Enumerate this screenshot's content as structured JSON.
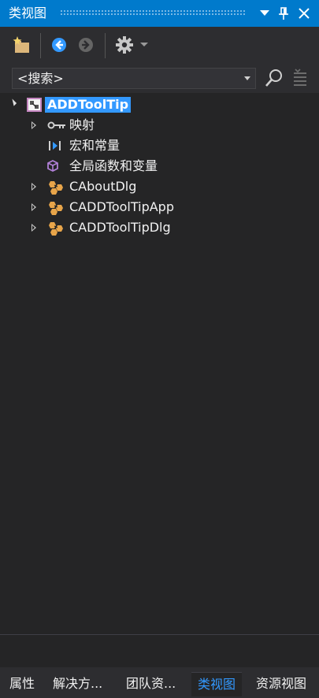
{
  "window": {
    "title": "类视图"
  },
  "toolbar": {
    "new_folder_icon": "new-folder-icon",
    "back_icon": "back-arrow-icon",
    "forward_icon": "forward-arrow-icon",
    "settings_icon": "gear-icon"
  },
  "search": {
    "value": "<搜索>"
  },
  "tree": {
    "root": {
      "label": "ADDToolTip"
    },
    "items": [
      {
        "label": "映射"
      },
      {
        "label": "宏和常量"
      },
      {
        "label": "全局函数和变量"
      },
      {
        "label": "CAboutDlg"
      },
      {
        "label": "CADDToolTipApp"
      },
      {
        "label": "CADDToolTipDlg"
      }
    ]
  },
  "tabs": [
    {
      "label": "属性"
    },
    {
      "label": "解决方..."
    },
    {
      "label": "团队资..."
    },
    {
      "label": "类视图"
    },
    {
      "label": "资源视图"
    }
  ],
  "colors": {
    "accent": "#007acc",
    "selection": "#3399ff",
    "background": "#252526"
  }
}
